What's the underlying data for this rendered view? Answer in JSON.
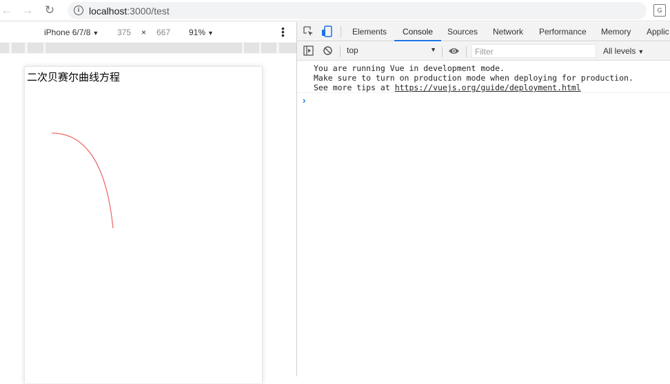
{
  "browser": {
    "url_host": "localhost",
    "url_path": ":3000/test",
    "back_icon": "arrow-left",
    "forward_icon": "arrow-right",
    "reload_icon": "reload"
  },
  "device_toolbar": {
    "device": "iPhone 6/7/8",
    "width": "375",
    "times": "×",
    "height": "667",
    "zoom": "91%"
  },
  "page": {
    "title": "二次贝赛尔曲线方程",
    "curve_color": "#ee6d6d"
  },
  "devtools": {
    "tabs": [
      "Elements",
      "Console",
      "Sources",
      "Network",
      "Performance",
      "Memory",
      "Applic"
    ],
    "active_tab": "Console",
    "context": "top",
    "filter_placeholder": "Filter",
    "levels": "All levels",
    "console": {
      "line1": "You are running Vue in development mode.",
      "line2": "Make sure to turn on production mode when deploying for production.",
      "line3_prefix": "See more tips at ",
      "line3_link": "https://vuejs.org/guide/deployment.html"
    },
    "accent": "#1a73e8"
  }
}
